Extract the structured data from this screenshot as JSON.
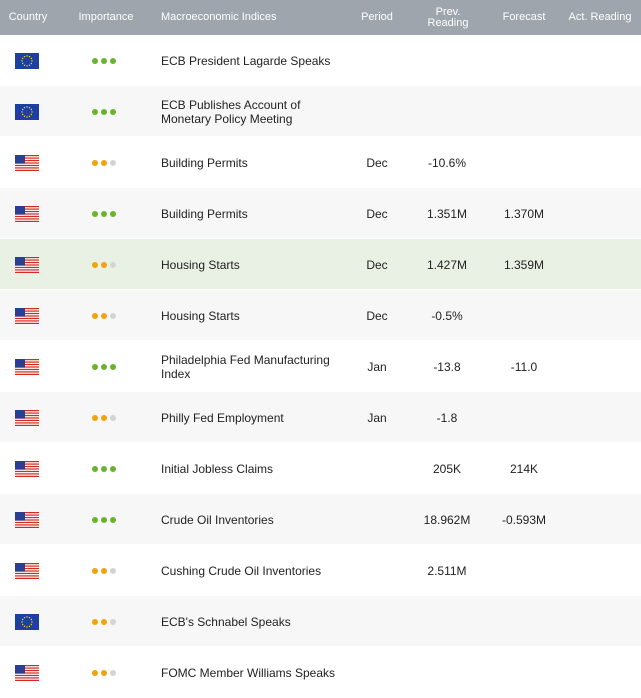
{
  "header": {
    "country": "Country",
    "importance": "Importance",
    "indices": "Macroeconomic Indices",
    "period": "Period",
    "prev": "Prev. Reading",
    "forecast": "Forecast",
    "actual": "Act. Reading"
  },
  "colors": {
    "importance_high": "#6ab42d",
    "importance_medium": "#f0a30a",
    "importance_off": "#d4d4d4"
  },
  "rows": [
    {
      "flag": "eu-flag-icon",
      "importance": 3,
      "name": "ECB President Lagarde Speaks",
      "period": "",
      "prev": "",
      "forecast": "",
      "actual": ""
    },
    {
      "flag": "eu-flag-icon",
      "importance": 3,
      "name": "ECB Publishes Account of Monetary Policy Meeting",
      "period": "",
      "prev": "",
      "forecast": "",
      "actual": ""
    },
    {
      "flag": "us-flag-icon",
      "importance": 2,
      "name": "Building Permits",
      "period": "Dec",
      "prev": "-10.6%",
      "forecast": "",
      "actual": ""
    },
    {
      "flag": "us-flag-icon",
      "importance": 3,
      "name": "Building Permits",
      "period": "Dec",
      "prev": "1.351M",
      "forecast": "1.370M",
      "actual": ""
    },
    {
      "flag": "us-flag-icon",
      "importance": 2,
      "name": "Housing Starts",
      "period": "Dec",
      "prev": "1.427M",
      "forecast": "1.359M",
      "actual": "",
      "highlight": true
    },
    {
      "flag": "us-flag-icon",
      "importance": 2,
      "name": "Housing Starts",
      "period": "Dec",
      "prev": "-0.5%",
      "forecast": "",
      "actual": ""
    },
    {
      "flag": "us-flag-icon",
      "importance": 3,
      "name": "Philadelphia Fed Manufacturing Index",
      "period": "Jan",
      "prev": "-13.8",
      "forecast": "-11.0",
      "actual": ""
    },
    {
      "flag": "us-flag-icon",
      "importance": 2,
      "name": "Philly Fed Employment",
      "period": "Jan",
      "prev": "-1.8",
      "forecast": "",
      "actual": ""
    },
    {
      "flag": "us-flag-icon",
      "importance": 3,
      "name": "Initial Jobless Claims",
      "period": "",
      "prev": "205K",
      "forecast": "214K",
      "actual": ""
    },
    {
      "flag": "us-flag-icon",
      "importance": 3,
      "name": "Crude Oil Inventories",
      "period": "",
      "prev": "18.962M",
      "forecast": "-0.593M",
      "actual": ""
    },
    {
      "flag": "us-flag-icon",
      "importance": 2,
      "name": "Cushing Crude Oil Inventories",
      "period": "",
      "prev": "2.511M",
      "forecast": "",
      "actual": ""
    },
    {
      "flag": "eu-flag-icon",
      "importance": 2,
      "name": "ECB's Schnabel Speaks",
      "period": "",
      "prev": "",
      "forecast": "",
      "actual": ""
    },
    {
      "flag": "us-flag-icon",
      "importance": 2,
      "name": "FOMC Member Williams Speaks",
      "period": "",
      "prev": "",
      "forecast": "",
      "actual": ""
    }
  ]
}
